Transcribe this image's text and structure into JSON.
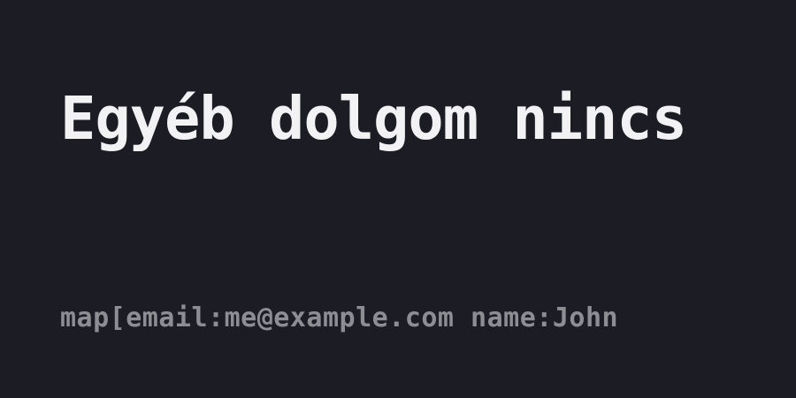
{
  "card": {
    "title": "Egyéb dolgom nincs",
    "subtitle": "map[email:me@example.com name:John",
    "colors": {
      "background": "#1b1c24",
      "title": "#f2f2f4",
      "subtitle": "#8d8e93"
    }
  }
}
